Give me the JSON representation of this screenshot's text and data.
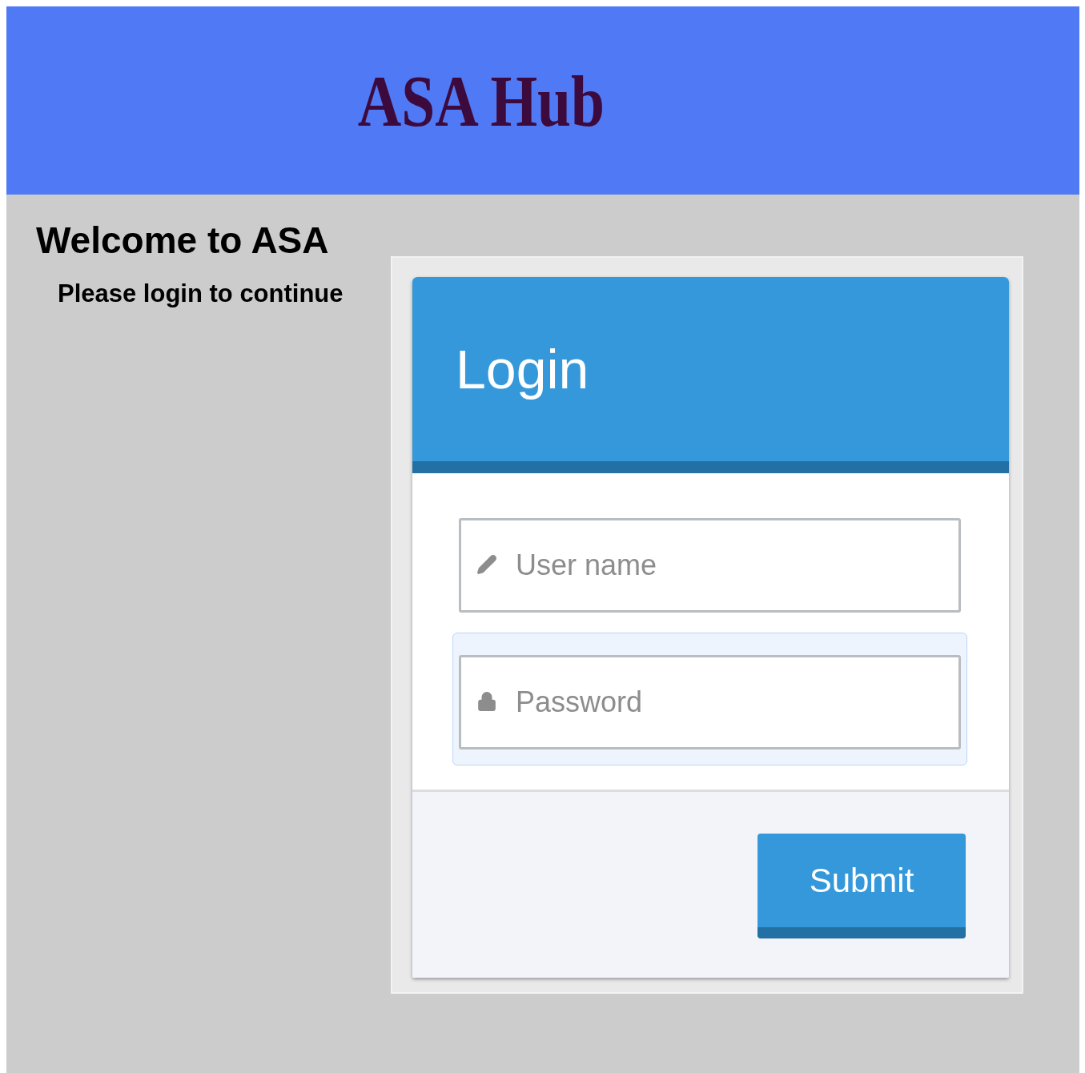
{
  "header": {
    "title": "ASA Hub"
  },
  "welcome": {
    "heading": "Welcome to ASA",
    "subheading": "Please login to continue"
  },
  "login": {
    "title": "Login",
    "fields": [
      {
        "kind": "text",
        "placeholder": "User name",
        "focused": false
      },
      {
        "kind": "password",
        "placeholder": "Password",
        "focused": true
      }
    ],
    "submit": "Submit"
  }
}
